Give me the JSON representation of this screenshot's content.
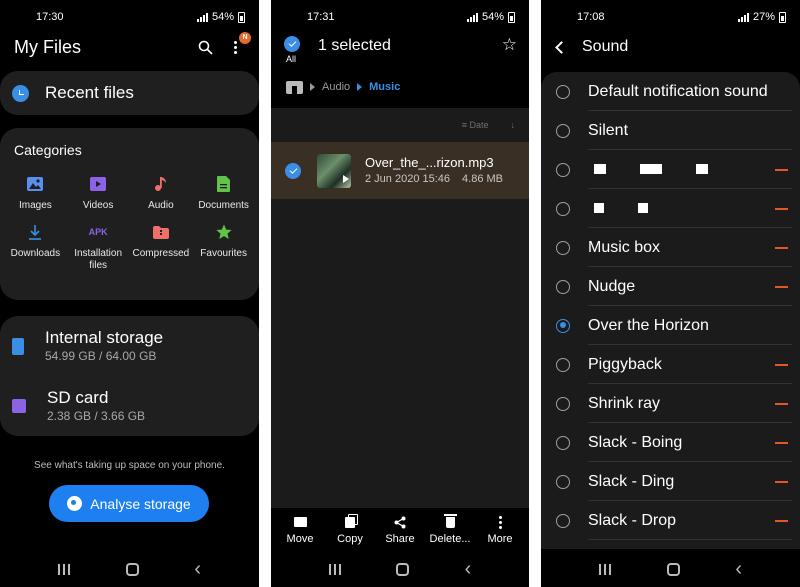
{
  "panel1": {
    "status": {
      "time": "17:30",
      "battery": "54%"
    },
    "title": "My Files",
    "badge": "N",
    "recent_label": "Recent files",
    "categories_title": "Categories",
    "categories": [
      {
        "label": "Images",
        "icon": "image-icon",
        "color": "#5a8ff0"
      },
      {
        "label": "Videos",
        "icon": "video-icon",
        "color": "#8a63e6"
      },
      {
        "label": "Audio",
        "icon": "music-note-icon",
        "color": "#ef6f6a"
      },
      {
        "label": "Documents",
        "icon": "document-icon",
        "color": "#63c24a"
      },
      {
        "label": "Downloads",
        "icon": "download-icon",
        "color": "#3a8ee6"
      },
      {
        "label": "Installation files",
        "icon": "apk-icon",
        "color": "#8a63e6"
      },
      {
        "label": "Compressed",
        "icon": "archive-icon",
        "color": "#ef6f6a"
      },
      {
        "label": "Favourites",
        "icon": "star-icon",
        "color": "#63c24a"
      }
    ],
    "apk_text": "APK",
    "storage": [
      {
        "name": "Internal storage",
        "usage": "54.99 GB / 64.00 GB",
        "color": "#3a8ee6"
      },
      {
        "name": "SD card",
        "usage": "2.38 GB / 3.66 GB",
        "color": "#8a63e6"
      }
    ],
    "hint": "See what's taking up space on your phone.",
    "analyse_label": "Analyse storage"
  },
  "panel2": {
    "status": {
      "time": "17:31",
      "battery": "54%"
    },
    "all_label": "All",
    "title": "1 selected",
    "breadcrumb": [
      "Audio",
      "Music"
    ],
    "sort_label": "Date",
    "file": {
      "name": "Over_the_...rizon.mp3",
      "date": "2 Jun 2020 15:46",
      "size": "4.86 MB"
    },
    "actions": [
      {
        "label": "Move",
        "icon": "move-icon"
      },
      {
        "label": "Copy",
        "icon": "copy-icon"
      },
      {
        "label": "Share",
        "icon": "share-icon"
      },
      {
        "label": "Delete...",
        "icon": "delete-icon"
      },
      {
        "label": "More",
        "icon": "more-icon"
      }
    ]
  },
  "panel3": {
    "status": {
      "time": "17:08",
      "battery": "27%"
    },
    "title": "Sound",
    "sounds": [
      {
        "label": "Default notification sound",
        "selected": false,
        "removable": false
      },
      {
        "label": "Silent",
        "selected": false,
        "removable": false
      },
      {
        "label": "",
        "selected": false,
        "removable": true,
        "redacted": true
      },
      {
        "label": "",
        "selected": false,
        "removable": true,
        "redacted": true
      },
      {
        "label": "Music box",
        "selected": false,
        "removable": true
      },
      {
        "label": "Nudge",
        "selected": false,
        "removable": true
      },
      {
        "label": "Over the Horizon",
        "selected": true,
        "removable": false
      },
      {
        "label": "Piggyback",
        "selected": false,
        "removable": true
      },
      {
        "label": "Shrink ray",
        "selected": false,
        "removable": true
      },
      {
        "label": "Slack - Boing",
        "selected": false,
        "removable": true
      },
      {
        "label": "Slack - Ding",
        "selected": false,
        "removable": true
      },
      {
        "label": "Slack - Drop",
        "selected": false,
        "removable": true
      }
    ],
    "accent": "#3a8ee6",
    "remove_color": "#e2572a"
  }
}
